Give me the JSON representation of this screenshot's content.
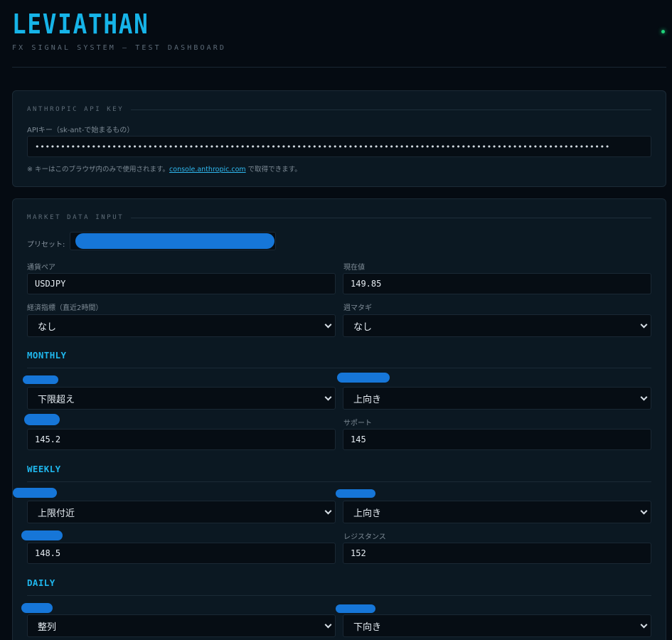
{
  "app": {
    "title": "LEVIATHAN",
    "subtitle": "FX SIGNAL SYSTEM — TEST DASHBOARD"
  },
  "api": {
    "section_title": "ANTHROPIC API KEY",
    "field_label": "APIキー（sk-ant-で始まるもの）",
    "masked_value": "••••••••••••••••••••••••••••••••••••••••••••••••••••••••••••••••••••••••••••••••••••••••••••••••••••••••••••••••",
    "note_prefix": "※ キーはこのブラウザ内のみで使用されます。",
    "note_link": "console.anthropic.com",
    "note_suffix": " で取得できます。"
  },
  "market": {
    "section_title": "MARKET DATA INPUT",
    "preset_label": "プリセット:",
    "pair_label": "通貨ペア",
    "pair_value": "USDJPY",
    "price_label": "現在値",
    "price_value": "149.85",
    "econ_label": "経済指標（直近2時間）",
    "econ_value": "なし",
    "weekcross_label": "週マタギ",
    "weekcross_value": "なし"
  },
  "monthly": {
    "title": "MONTHLY",
    "select_left": "下限超え",
    "select_right": "上向き",
    "input_left": "145.2",
    "support_label": "サポート",
    "input_right": "145"
  },
  "weekly": {
    "title": "WEEKLY",
    "select_left": "上限付近",
    "select_right": "上向き",
    "input_left": "148.5",
    "resistance_label": "レジスタンス",
    "input_right": "152"
  },
  "daily": {
    "title": "DAILY",
    "select_left": "整列",
    "select_right": "下向き"
  },
  "colors": {
    "accent": "#16b4e8",
    "status": "#1fd27a",
    "redaction": "#1676d8"
  }
}
